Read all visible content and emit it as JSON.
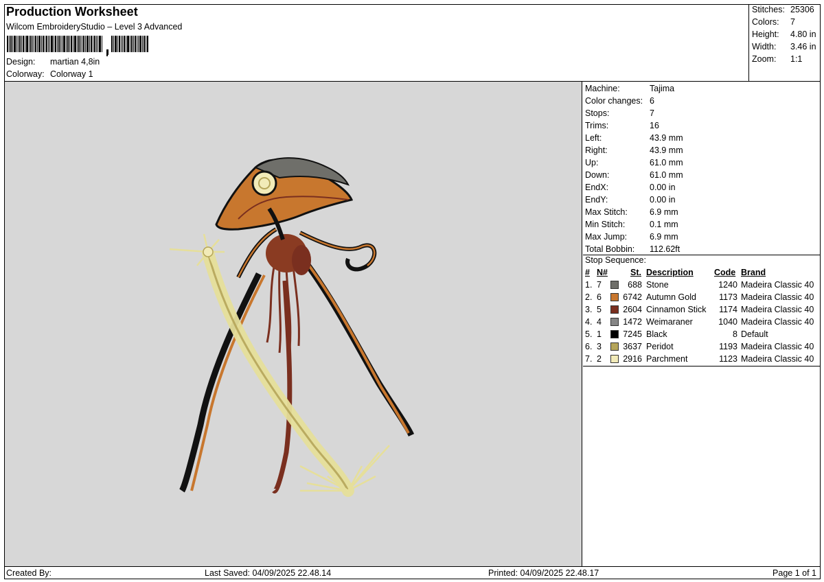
{
  "header": {
    "title": "Production Worksheet",
    "subtitle": "Wilcom EmbroideryStudio – Level 3 Advanced",
    "design_label": "Design:",
    "design_value": "martian 4,8in",
    "colorway_label": "Colorway:",
    "colorway_value": "Colorway 1"
  },
  "stats": [
    {
      "label": "Stitches:",
      "value": "25306"
    },
    {
      "label": "Colors:",
      "value": "7"
    },
    {
      "label": "Height:",
      "value": "4.80 in"
    },
    {
      "label": "Width:",
      "value": "3.46 in"
    },
    {
      "label": "Zoom:",
      "value": "1:1"
    }
  ],
  "info": [
    {
      "label": "Machine:",
      "value": "Tajima"
    },
    {
      "label": "Color changes:",
      "value": "6"
    },
    {
      "label": "Stops:",
      "value": "7"
    },
    {
      "label": "Trims:",
      "value": "16"
    },
    {
      "label": "Left:",
      "value": "43.9 mm"
    },
    {
      "label": "Right:",
      "value": "43.9 mm"
    },
    {
      "label": "Up:",
      "value": "61.0 mm"
    },
    {
      "label": "Down:",
      "value": "61.0 mm"
    },
    {
      "label": "EndX:",
      "value": "0.00 in"
    },
    {
      "label": "EndY:",
      "value": "0.00 in"
    },
    {
      "label": "Max Stitch:",
      "value": "6.9 mm"
    },
    {
      "label": "Min Stitch:",
      "value": "0.1 mm"
    },
    {
      "label": "Max Jump:",
      "value": "6.9 mm"
    },
    {
      "label": "Total Bobbin:",
      "value": "112.62ft"
    }
  ],
  "sequence": {
    "title": "Stop Sequence:",
    "headers": {
      "num": "#",
      "n": "N#",
      "st": "St.",
      "description": "Description",
      "code": "Code",
      "brand": "Brand"
    },
    "rows": [
      {
        "num": "1.",
        "n": "7",
        "color": "#6f6f6a",
        "st": "688",
        "description": "Stone",
        "code": "1240",
        "brand": "Madeira Classic 40"
      },
      {
        "num": "2.",
        "n": "6",
        "color": "#c8772e",
        "st": "6742",
        "description": "Autumn Gold",
        "code": "1173",
        "brand": "Madeira Classic 40"
      },
      {
        "num": "3.",
        "n": "5",
        "color": "#7a2f1f",
        "st": "2604",
        "description": "Cinnamon Stick",
        "code": "1174",
        "brand": "Madeira Classic 40"
      },
      {
        "num": "4.",
        "n": "4",
        "color": "#858585",
        "st": "1472",
        "description": "Weimaraner",
        "code": "1040",
        "brand": "Madeira Classic 40"
      },
      {
        "num": "5.",
        "n": "1",
        "color": "#000000",
        "st": "7245",
        "description": "Black",
        "code": "8",
        "brand": "Default"
      },
      {
        "num": "6.",
        "n": "3",
        "color": "#b5a55a",
        "st": "3637",
        "description": "Peridot",
        "code": "1193",
        "brand": "Madeira Classic 40"
      },
      {
        "num": "7.",
        "n": "2",
        "color": "#f2ebb8",
        "st": "2916",
        "description": "Parchment",
        "code": "1123",
        "brand": "Madeira Classic 40"
      }
    ]
  },
  "footer": {
    "created_by": "Created By:",
    "last_saved": "Last Saved: 04/09/2025 22.48.14",
    "printed": "Printed: 04/09/2025 22.48.17",
    "page": "Page 1 of 1"
  }
}
